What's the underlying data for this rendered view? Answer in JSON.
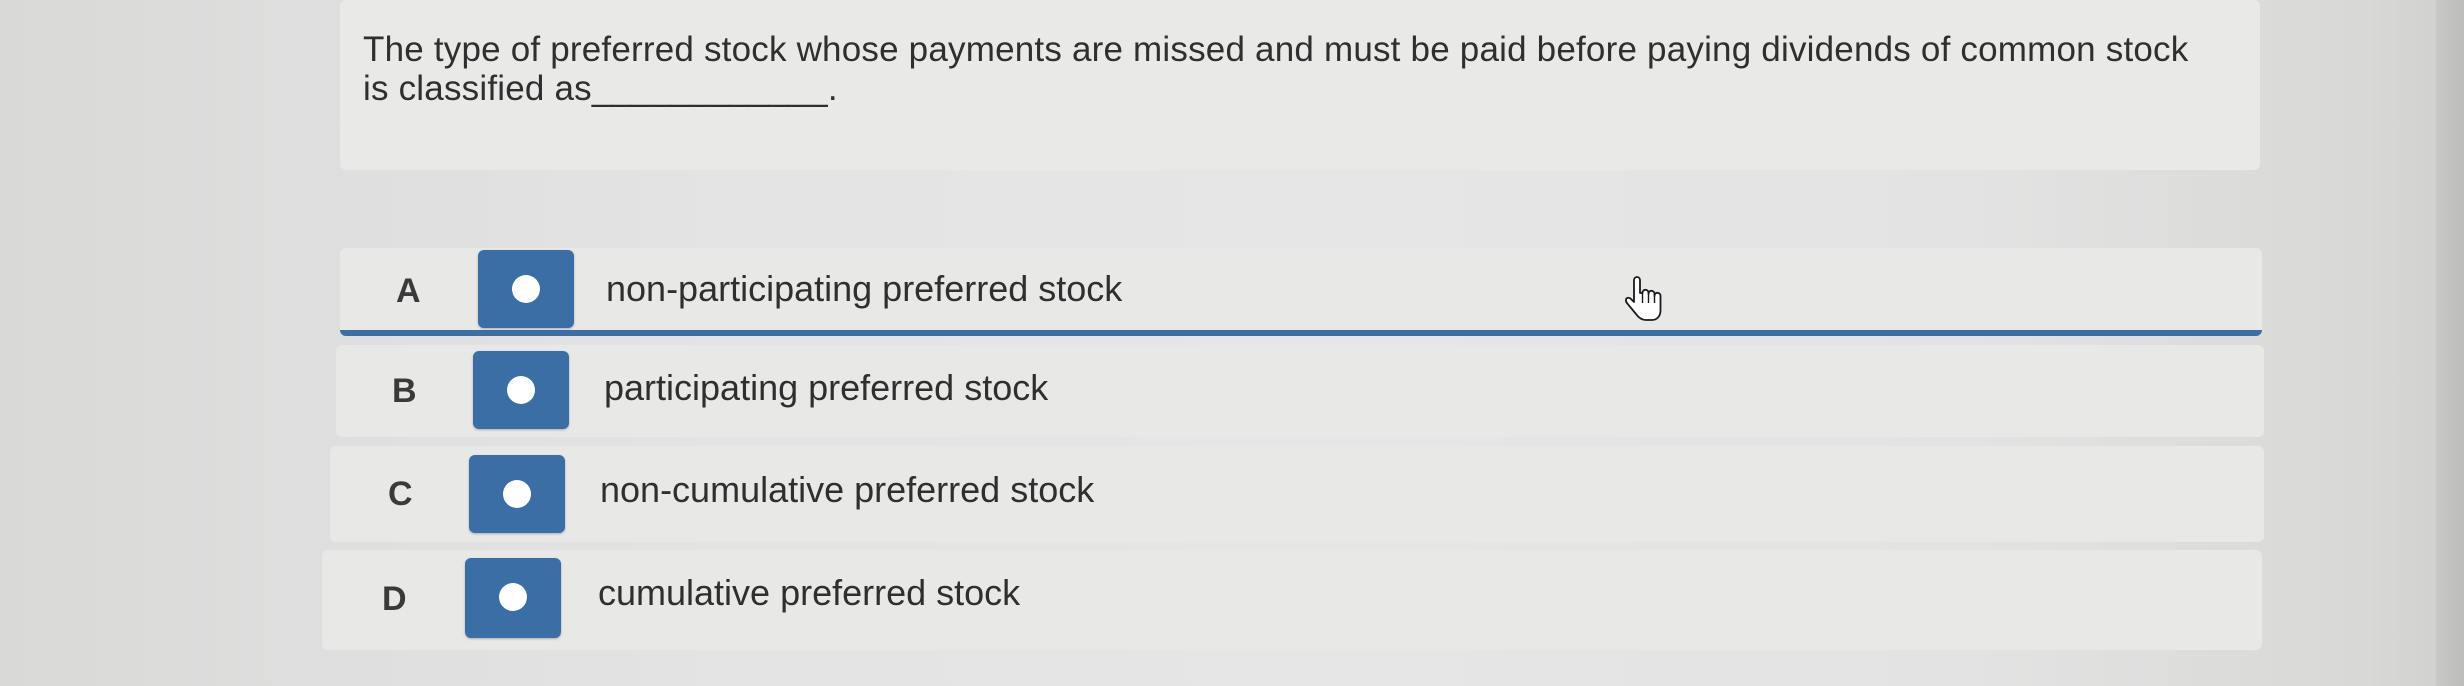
{
  "question": {
    "text": "The type of preferred stock whose payments are missed and must be paid before paying dividends of common stock is classified as____________."
  },
  "options": [
    {
      "letter": "A",
      "label": "non-participating preferred stock",
      "selected": true
    },
    {
      "letter": "B",
      "label": "participating preferred stock",
      "selected": false
    },
    {
      "letter": "C",
      "label": "non-cumulative preferred stock",
      "selected": false
    },
    {
      "letter": "D",
      "label": "cumulative preferred stock",
      "selected": false
    }
  ],
  "colors": {
    "accent": "#3b6ea5",
    "selected_underline": "#3b6fa4",
    "text": "#2f2f2f"
  },
  "cursor": {
    "icon": "hand-pointer-icon"
  }
}
